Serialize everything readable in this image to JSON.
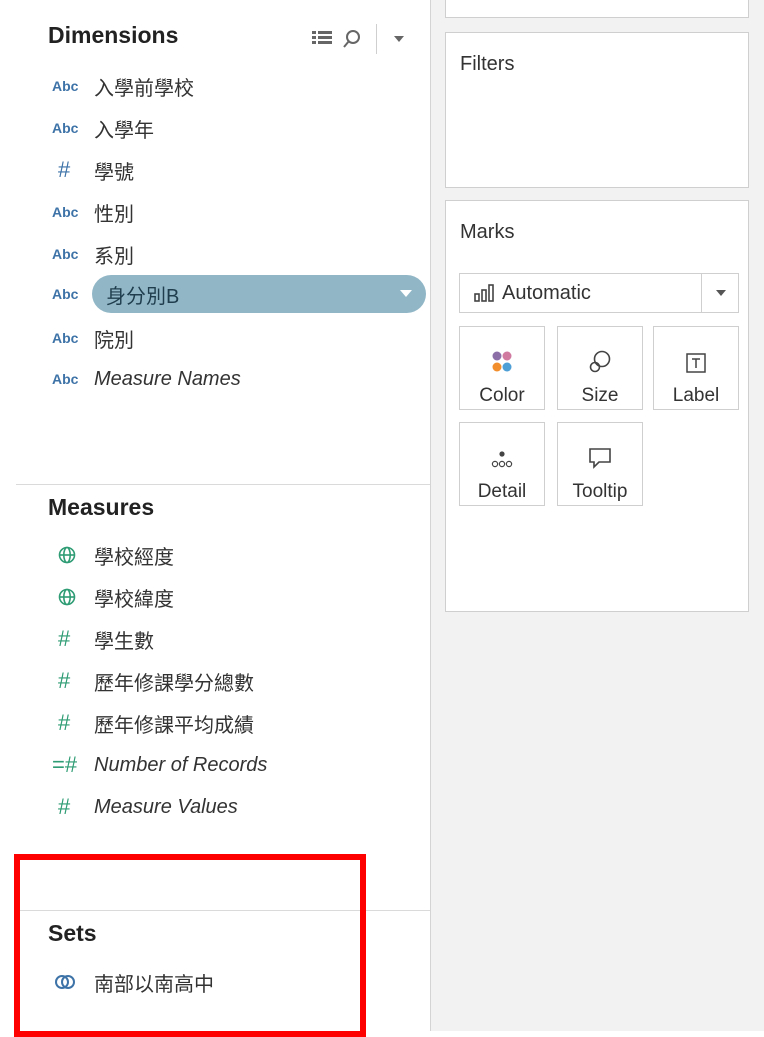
{
  "data_pane": {
    "dimensions_title": "Dimensions",
    "dimensions": [
      {
        "type": "Abc",
        "label": "入學前學校"
      },
      {
        "type": "Abc",
        "label": "入學年"
      },
      {
        "type": "#",
        "label": "學號"
      },
      {
        "type": "Abc",
        "label": "性別"
      },
      {
        "type": "Abc",
        "label": "系別"
      },
      {
        "type": "Abc",
        "label": "身分別B",
        "selected": true
      },
      {
        "type": "Abc",
        "label": "院別"
      },
      {
        "type": "Abc",
        "label": "Measure Names",
        "italic": true
      }
    ],
    "measures_title": "Measures",
    "measures": [
      {
        "type": "globe",
        "label": "學校經度"
      },
      {
        "type": "globe",
        "label": "學校緯度"
      },
      {
        "type": "#",
        "label": "學生數"
      },
      {
        "type": "#",
        "label": "歷年修課學分總數"
      },
      {
        "type": "#",
        "label": "歷年修課平均成績"
      },
      {
        "type": "=#",
        "label": "Number of Records",
        "italic": true
      },
      {
        "type": "#",
        "label": "Measure Values",
        "italic": true
      }
    ],
    "sets_title": "Sets",
    "sets": [
      {
        "type": "set",
        "label": "南部以南高中"
      }
    ]
  },
  "shelves": {
    "filters_title": "Filters",
    "marks_title": "Marks",
    "mark_type": "Automatic",
    "mark_buttons": [
      {
        "label": "Color",
        "icon": "color-dots-icon"
      },
      {
        "label": "Size",
        "icon": "size-icon"
      },
      {
        "label": "Label",
        "icon": "label-icon"
      },
      {
        "label": "Detail",
        "icon": "detail-icon"
      },
      {
        "label": "Tooltip",
        "icon": "tooltip-icon"
      }
    ]
  },
  "colors": {
    "dimension_blue": "#3e73a8",
    "measure_green": "#2e9c74",
    "pill_fill": "#91b7c7",
    "highlight_red": "#ff0000"
  }
}
